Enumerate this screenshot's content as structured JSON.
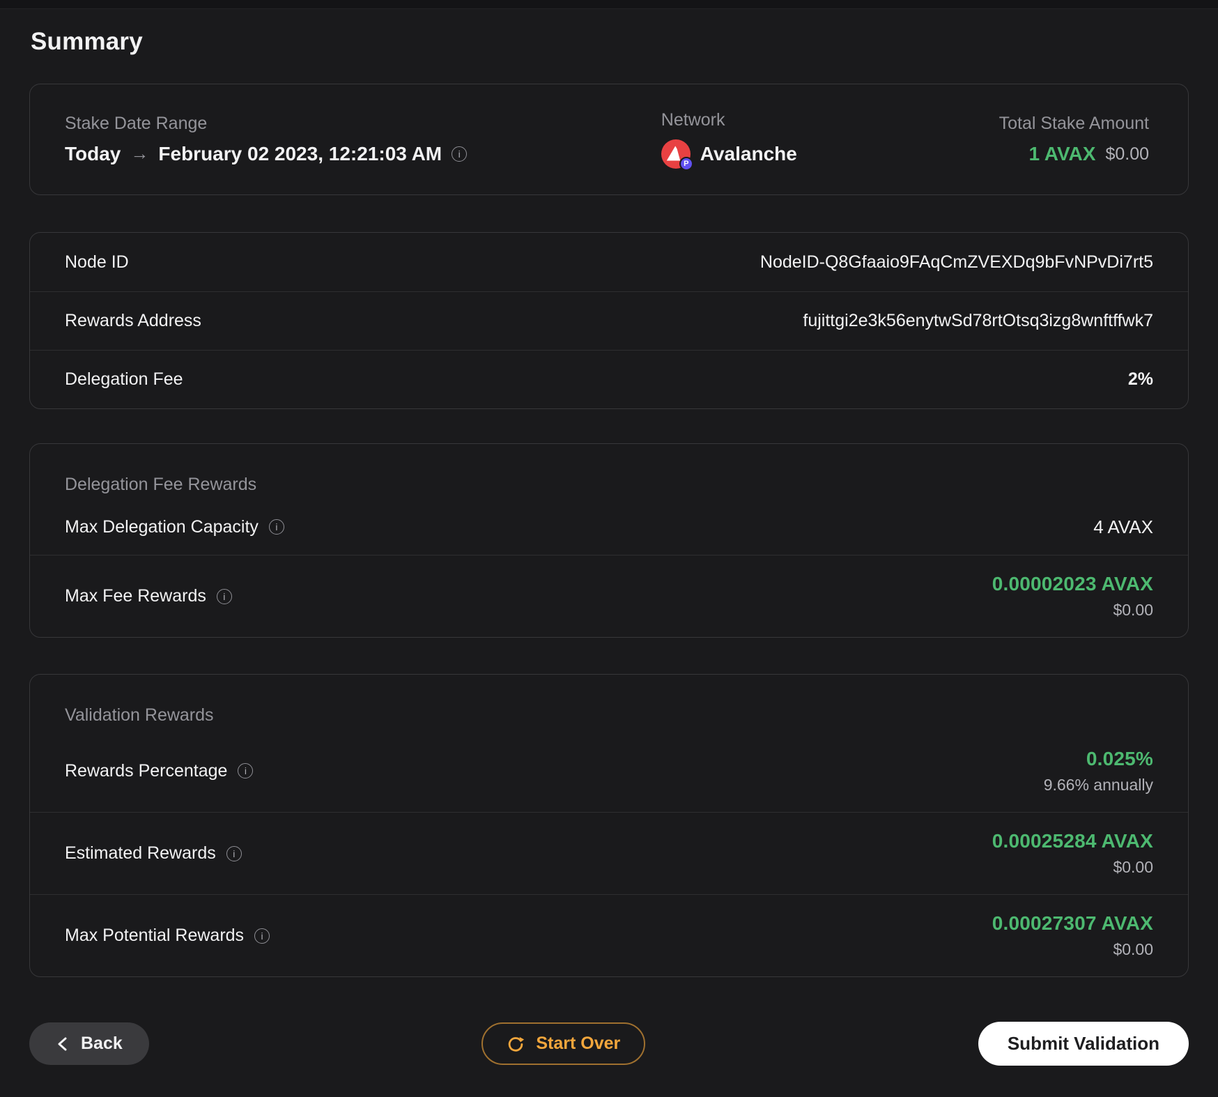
{
  "page": {
    "title": "Summary"
  },
  "header_card": {
    "stake_date_range": {
      "label": "Stake Date Range",
      "from": "Today",
      "arrow": "→",
      "to": "February 02 2023, 12:21:03 AM"
    },
    "network": {
      "label": "Network",
      "value": "Avalanche",
      "badge": "P"
    },
    "total_stake": {
      "label": "Total Stake Amount",
      "amount": "1 AVAX",
      "usd": "$0.00"
    }
  },
  "details_table": {
    "rows": [
      {
        "label": "Node ID",
        "value": "NodeID-Q8Gfaaio9FAqCmZVEXDq9bFvNPvDi7rt5"
      },
      {
        "label": "Rewards Address",
        "value": "fujittgi2e3k56enytwSd78rtOtsq3izg8wnftffwk7"
      },
      {
        "label": "Delegation Fee",
        "value": "2%"
      }
    ]
  },
  "delegation_fee_rewards": {
    "title": "Delegation Fee Rewards",
    "rows": [
      {
        "label": "Max Delegation Capacity",
        "value": "4 AVAX"
      },
      {
        "label": "Max Fee Rewards",
        "value": "0.00002023 AVAX",
        "sub": "$0.00"
      }
    ]
  },
  "validation_rewards": {
    "title": "Validation Rewards",
    "rows": [
      {
        "label": "Rewards Percentage",
        "value": "0.025%",
        "sub": "9.66% annually"
      },
      {
        "label": "Estimated Rewards",
        "value": "0.00025284 AVAX",
        "sub": "$0.00"
      },
      {
        "label": "Max Potential Rewards",
        "value": "0.00027307 AVAX",
        "sub": "$0.00"
      }
    ]
  },
  "footer": {
    "back_label": "Back",
    "start_over_label": "Start Over",
    "submit_label": "Submit Validation"
  },
  "colors": {
    "accent_green": "#4db970",
    "accent_orange": "#f2a63c",
    "avalanche_red": "#e84142",
    "p_chain_badge": "#6050f0"
  }
}
